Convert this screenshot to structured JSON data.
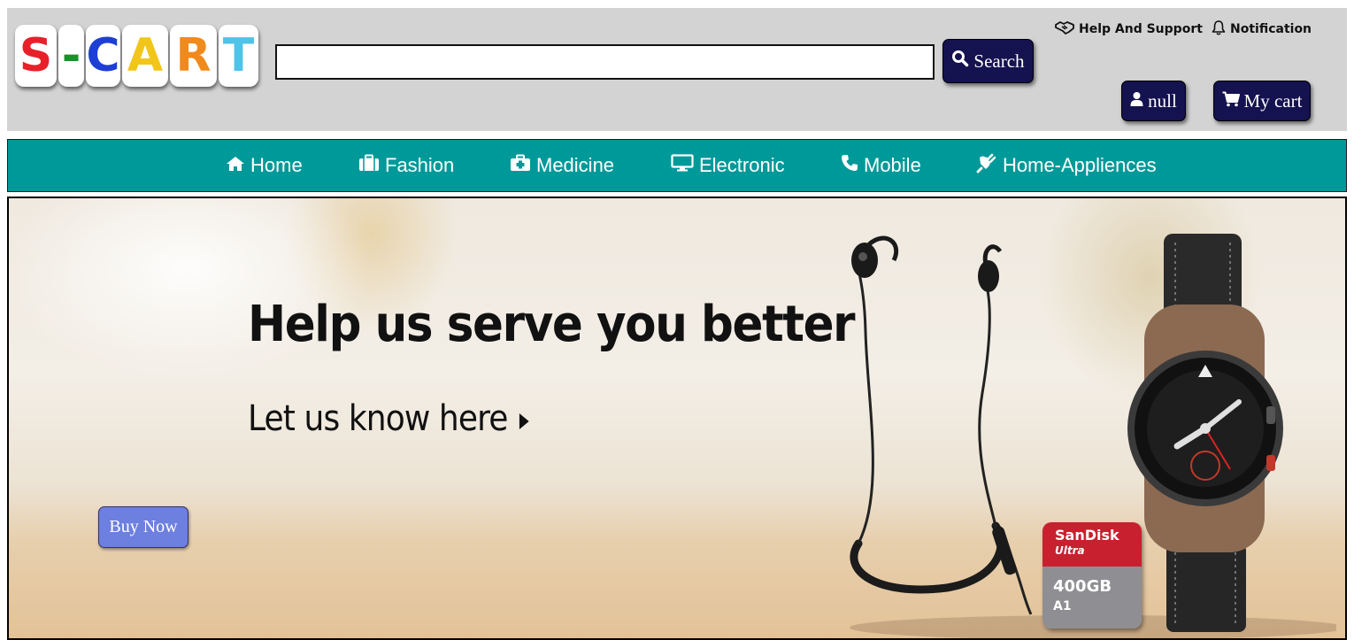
{
  "header": {
    "logo_letters": [
      {
        "char": "S",
        "color": "#e8202a"
      },
      {
        "char": "-",
        "color": "#1f8f2a"
      },
      {
        "char": "C",
        "color": "#1d3fd6"
      },
      {
        "char": "A",
        "color": "#f2c51b"
      },
      {
        "char": "R",
        "color": "#f18a1c"
      },
      {
        "char": "T",
        "color": "#4fc3e8"
      }
    ],
    "search": {
      "value": "",
      "placeholder": "",
      "button_label": "Search",
      "icon": "search-icon"
    },
    "links": {
      "help": {
        "label": "Help And Support",
        "icon": "handshake-icon"
      },
      "notification": {
        "label": "Notification",
        "icon": "bell-icon"
      }
    },
    "user": {
      "label": "null",
      "icon": "user-icon"
    },
    "cart": {
      "label": "My cart",
      "icon": "cart-icon"
    }
  },
  "nav": {
    "items": [
      {
        "label": "Home",
        "icon": "home-icon"
      },
      {
        "label": "Fashion",
        "icon": "briefcase-icon"
      },
      {
        "label": "Medicine",
        "icon": "medkit-icon"
      },
      {
        "label": "Electronic",
        "icon": "monitor-icon"
      },
      {
        "label": "Mobile",
        "icon": "phone-icon"
      },
      {
        "label": "Home-Appliences",
        "icon": "plug-icon"
      }
    ]
  },
  "banner": {
    "headline": "Help us serve you better",
    "subline": "Let us know here",
    "button_label": "Buy Now",
    "sd_card": {
      "brand": "SanDisk",
      "line": "Ultra",
      "capacity": "400GB",
      "rating": "A1"
    }
  },
  "colors": {
    "header_bg": "#d3d3d3",
    "nav_bg": "#009999",
    "button_dark": "#14124f",
    "buy_button": "#6d7fdf"
  }
}
